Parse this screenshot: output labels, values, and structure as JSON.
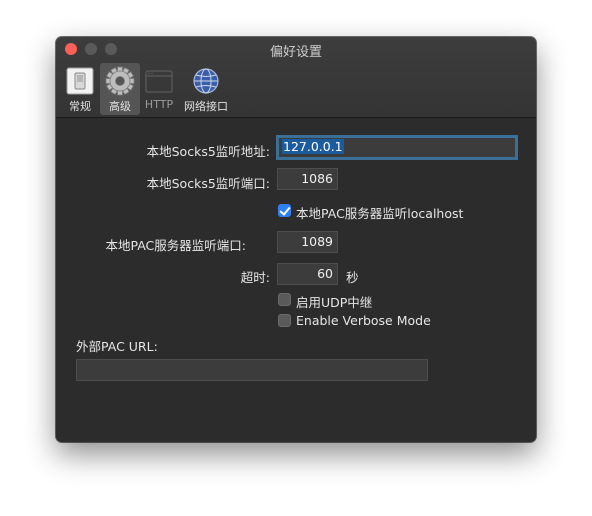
{
  "window": {
    "title": "偏好设置"
  },
  "toolbar": [
    {
      "label": "常规",
      "icon": "switch-icon",
      "selected": false,
      "enabled": true
    },
    {
      "label": "高级",
      "icon": "gear-icon",
      "selected": true,
      "enabled": true
    },
    {
      "label": "HTTP",
      "icon": "http-icon",
      "selected": false,
      "enabled": false
    },
    {
      "label": "网络接口",
      "icon": "globe-icon",
      "selected": false,
      "enabled": true
    }
  ],
  "advanced": {
    "socks_address_label": "本地Socks5监听地址:",
    "socks_address_value": "127.0.0.1",
    "socks_port_label": "本地Socks5监听端口:",
    "socks_port_value": "1086",
    "pac_localhost_label": "本地PAC服务器监听localhost",
    "pac_localhost_checked": true,
    "pac_port_label": "本地PAC服务器监听端口:",
    "pac_port_value": "1089",
    "timeout_label": "超时:",
    "timeout_value": "60",
    "timeout_unit": "秒",
    "udp_relay_label": "启用UDP中继",
    "udp_relay_checked": false,
    "verbose_label": "Enable Verbose Mode",
    "verbose_checked": false,
    "external_pac_label": "外部PAC URL:",
    "external_pac_value": ""
  },
  "colors": {
    "accent": "#2f7ff5",
    "focus_ring": "#3a6f97",
    "close": "#fe5f57"
  }
}
